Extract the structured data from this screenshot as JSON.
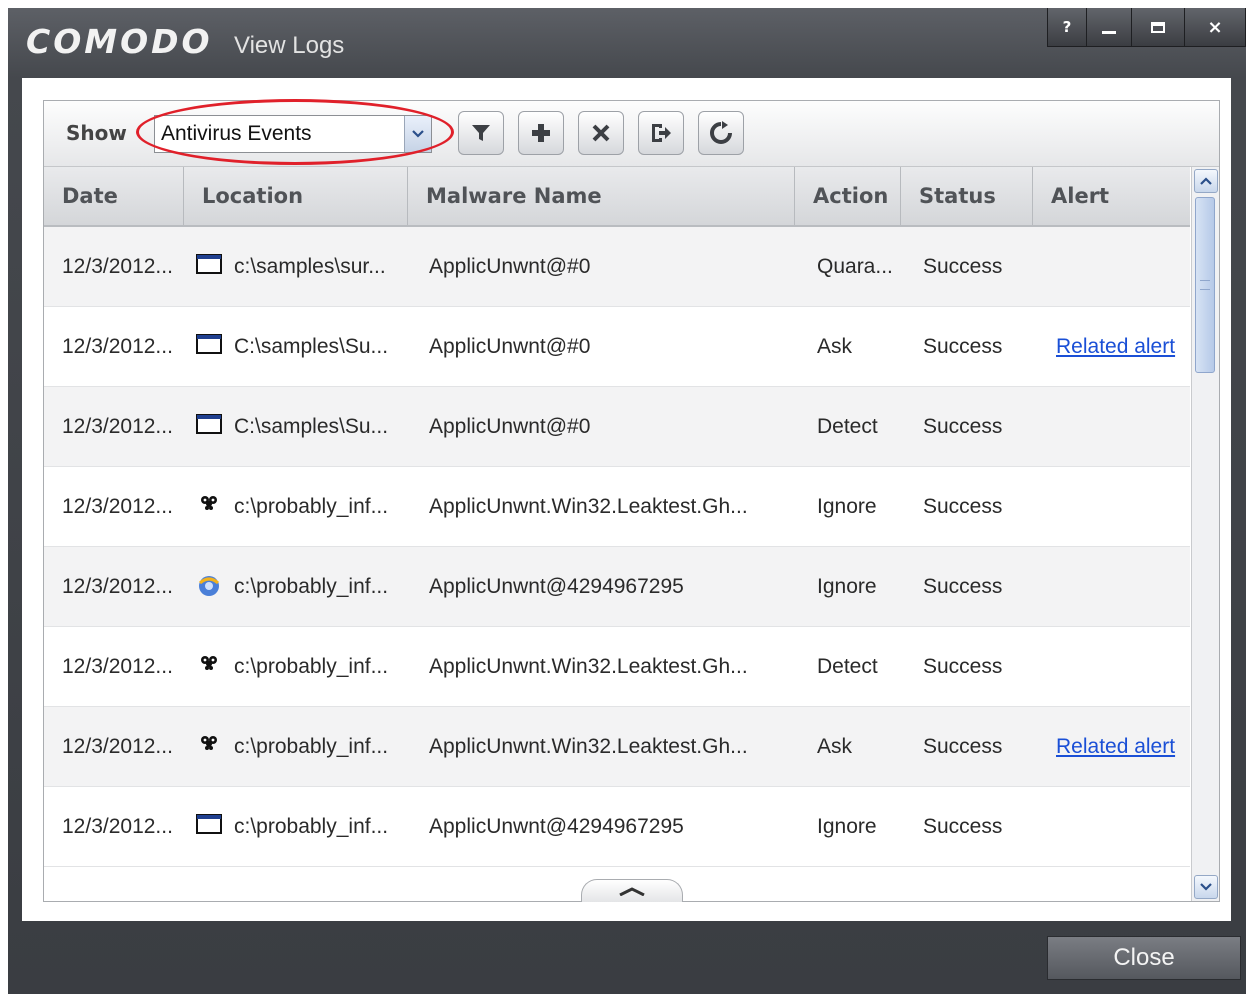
{
  "window": {
    "brand": "COMODO",
    "title": "View Logs",
    "help_label": "?",
    "close_label": "×"
  },
  "toolbar": {
    "show_label": "Show",
    "selected_log": "Antivirus Events",
    "buttons": [
      "filter-icon",
      "add-icon",
      "delete-icon",
      "export-icon",
      "refresh-icon"
    ]
  },
  "table": {
    "columns": [
      "Date",
      "Location",
      "Malware Name",
      "Action",
      "Status",
      "Alert"
    ],
    "rows": [
      {
        "date": "12/3/2012...",
        "icon": "window-icon",
        "location": "c:\\samples\\sur...",
        "malware": "ApplicUnwnt@#0",
        "action": "Quara...",
        "status": "Success",
        "alert": ""
      },
      {
        "date": "12/3/2012...",
        "icon": "window-icon",
        "location": "C:\\samples\\Su...",
        "malware": "ApplicUnwnt@#0",
        "action": "Ask",
        "status": "Success",
        "alert": "Related alert"
      },
      {
        "date": "12/3/2012...",
        "icon": "window-icon",
        "location": "C:\\samples\\Su...",
        "malware": "ApplicUnwnt@#0",
        "action": "Detect",
        "status": "Success",
        "alert": ""
      },
      {
        "date": "12/3/2012...",
        "icon": "bug-icon",
        "location": "c:\\probably_inf...",
        "malware": "ApplicUnwnt.Win32.Leaktest.Gh...",
        "action": "Ignore",
        "status": "Success",
        "alert": ""
      },
      {
        "date": "12/3/2012...",
        "icon": "shield-app-icon",
        "location": "c:\\probably_inf...",
        "malware": "ApplicUnwnt@4294967295",
        "action": "Ignore",
        "status": "Success",
        "alert": ""
      },
      {
        "date": "12/3/2012...",
        "icon": "bug-icon",
        "location": "c:\\probably_inf...",
        "malware": "ApplicUnwnt.Win32.Leaktest.Gh...",
        "action": "Detect",
        "status": "Success",
        "alert": ""
      },
      {
        "date": "12/3/2012...",
        "icon": "bug-icon",
        "location": "c:\\probably_inf...",
        "malware": "ApplicUnwnt.Win32.Leaktest.Gh...",
        "action": "Ask",
        "status": "Success",
        "alert": "Related alert"
      },
      {
        "date": "12/3/2012...",
        "icon": "window-icon",
        "location": "c:\\probably_inf...",
        "malware": "ApplicUnwnt@4294967295",
        "action": "Ignore",
        "status": "Success",
        "alert": ""
      }
    ]
  },
  "footer": {
    "close_label": "Close"
  },
  "colors": {
    "link": "#1a4fd6",
    "highlight": "#e0202a",
    "chrome": "#45484d"
  }
}
